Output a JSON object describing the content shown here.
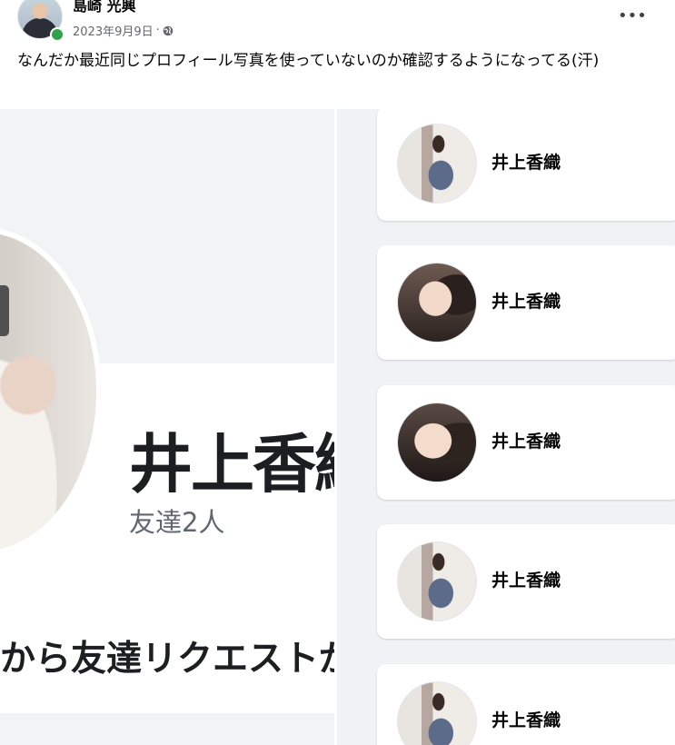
{
  "post": {
    "author": "島崎 光興",
    "date": "2023年9月9日",
    "separator": "·",
    "text": "なんだか最近同じプロフィール写真を使っていないのか確認するようになってる(汗)",
    "more_label": "•••"
  },
  "screenshot": {
    "profile_name": "井上香織",
    "friends_count": "友達2人",
    "request_text": "から友達リクエストが"
  },
  "list": {
    "items": [
      {
        "name": "井上香織",
        "avatar": "standing-photo"
      },
      {
        "name": "井上香織",
        "avatar": "selfie-smile"
      },
      {
        "name": "井上香織",
        "avatar": "selfie-hand"
      },
      {
        "name": "井上香織",
        "avatar": "standing-photo"
      },
      {
        "name": "井上香織",
        "avatar": "standing-photo"
      }
    ]
  },
  "colors": {
    "online": "#31a24c",
    "meta_gray": "#65676b",
    "list_bg": "#f0f2f5"
  },
  "icons": [
    "globe-icon",
    "more-options-icon",
    "online-status-icon"
  ]
}
